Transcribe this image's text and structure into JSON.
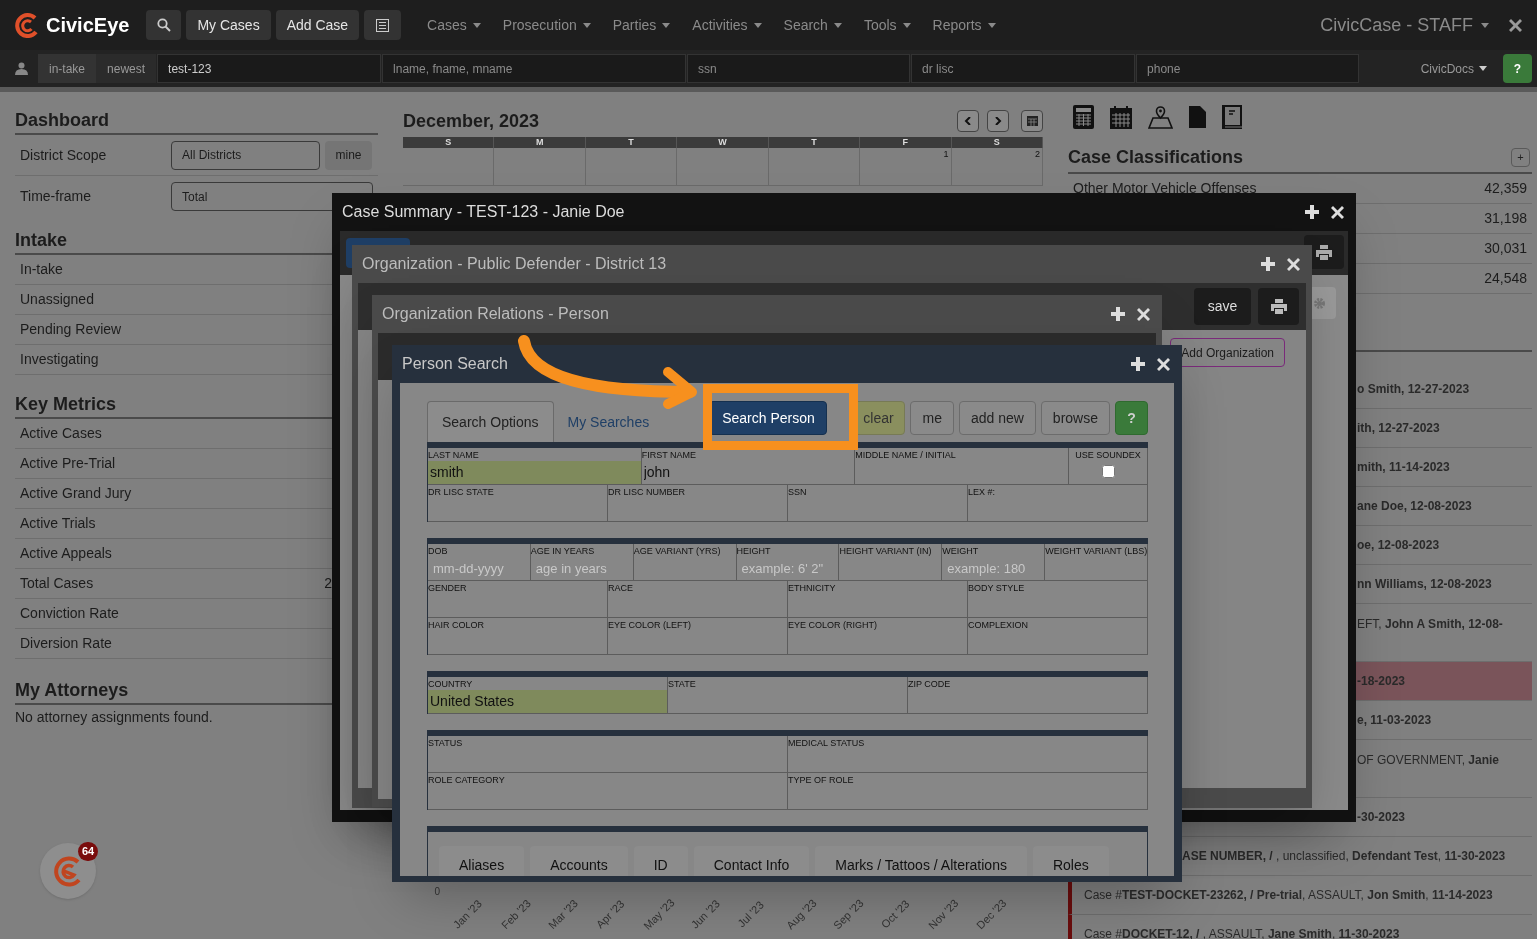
{
  "nav": {
    "brand": "CivicEye",
    "buttons": [
      "My Cases",
      "Add Case"
    ],
    "menus": [
      "Cases",
      "Prosecution",
      "Parties",
      "Activities",
      "Search",
      "Tools",
      "Reports"
    ],
    "app_title": "CivicCase - STAFF"
  },
  "quick_search": {
    "tags": [
      "in-take",
      "newest"
    ],
    "fields": [
      {
        "value": "test-123"
      },
      {
        "placeholder": "lname, fname, mname"
      },
      {
        "placeholder": "ssn"
      },
      {
        "placeholder": "dr lisc"
      },
      {
        "placeholder": "phone"
      }
    ],
    "docs": "CivicDocs",
    "help": "?"
  },
  "dashboard": {
    "title": "Dashboard",
    "scope_label": "District Scope",
    "scope_value": "All Districts",
    "mine": "mine",
    "timeframe_label": "Time-frame",
    "timeframe_value": "Total"
  },
  "intake": {
    "title": "Intake",
    "items": [
      "In-take",
      "Unassigned",
      "Pending Review",
      "Investigating"
    ]
  },
  "key_metrics": {
    "title": "Key Metrics",
    "items": [
      {
        "label": "Active Cases"
      },
      {
        "label": "Active Pre-Trial"
      },
      {
        "label": "Active Grand Jury"
      },
      {
        "label": "Active Trials"
      },
      {
        "label": "Active Appeals"
      },
      {
        "label": "Total Cases",
        "value": "2"
      },
      {
        "label": "Conviction Rate"
      },
      {
        "label": "Diversion Rate"
      }
    ]
  },
  "attorneys": {
    "title": "My Attorneys",
    "message": "No attorney assignments found."
  },
  "calendar": {
    "title": "December, 2023",
    "days": [
      "S",
      "M",
      "T",
      "W",
      "T",
      "F",
      "S"
    ],
    "first_week": [
      "1",
      "2"
    ]
  },
  "case_classifications": {
    "title": "Case Classifications",
    "add": "+",
    "rows": [
      {
        "label": "Other Motor Vehicle Offenses",
        "value": "42,359"
      },
      {
        "value": "31,198"
      },
      {
        "value": "30,031"
      },
      {
        "value": "24,548"
      }
    ]
  },
  "recent_cases": [
    {
      "text": "**o Smith, 12-27-2023**",
      "highlighted": false,
      "flagged": false
    },
    {
      "text": "**ith, 12-27-2023**",
      "highlighted": false,
      "flagged": false
    },
    {
      "text": "**mith, 11-14-2023**",
      "highlighted": false,
      "flagged": false
    },
    {
      "text": "**ane Doe, 12-08-2023**",
      "highlighted": false,
      "flagged": false
    },
    {
      "text": "**oe, 12-08-2023**",
      "highlighted": false,
      "flagged": false
    },
    {
      "text": "**nn Williams, 12-08-2023**",
      "highlighted": false,
      "flagged": false
    },
    {
      "text": "EFT, **John A Smith, 12-08-**",
      "highlighted": false,
      "flagged": false
    },
    {
      "text": "**-18-2023**",
      "highlighted": true,
      "flagged": false
    },
    {
      "text": "**e, 11-03-2023**",
      "highlighted": false,
      "flagged": false
    },
    {
      "text": "OF GOVERNMENT, **Janie**",
      "highlighted": false,
      "flagged": false
    },
    {
      "text": "**-30-2023**",
      "highlighted": false,
      "flagged": false
    },
    {
      "text": "**ASE NUMBER, /** , unclassified, **Defendant Test**, **11-30-2023**",
      "highlighted": false,
      "flagged": false
    },
    {
      "text": "Case #**TEST-DOCKET-23262, / Pre-trial**, ASSAULT, **Jon Smith**, **11-14-2023**",
      "highlighted": false,
      "flagged": true
    },
    {
      "text": "Case #**DOCKET-12, /** , ASSAULT, **Jane Smith**, **11-30-2023**",
      "highlighted": false,
      "flagged": true
    }
  ],
  "chart_axis": {
    "y_tick": "0",
    "months": [
      "Jan '23",
      "Feb '23",
      "Mar '23",
      "Apr '23",
      "May '23",
      "Jun '23",
      "Jul '23",
      "Aug '23",
      "Sep '23",
      "Oct '23",
      "Nov '23",
      "Dec '23"
    ]
  },
  "chat": {
    "badge": "64"
  },
  "case_summary": {
    "title": "Case Summary - TEST-123 - Janie Doe"
  },
  "organization": {
    "title": "Organization - Public Defender - District 13",
    "save": "save",
    "add_organization": "Add Organization"
  },
  "org_relations": {
    "title": "Organization Relations - Person"
  },
  "person_search": {
    "title": "Person Search",
    "tabs": [
      {
        "label": "Search Options",
        "selected": true
      },
      {
        "label": "My Searches",
        "selected": false
      }
    ],
    "buttons": [
      {
        "label": "Search Person",
        "kind": "primary"
      },
      {
        "label": "clear",
        "kind": "warning"
      },
      {
        "label": "me",
        "kind": "default"
      },
      {
        "label": "add new",
        "kind": "default"
      },
      {
        "label": "browse",
        "kind": "default"
      },
      {
        "label": "?",
        "kind": "help"
      }
    ],
    "form": [
      {
        "rows": [
          [
            {
              "label": "LAST NAME",
              "value": "smith",
              "highlighted": true
            },
            {
              "label": "FIRST NAME",
              "value": "john",
              "highlighted": false
            },
            {
              "label": "MIDDLE NAME / INITIAL",
              "highlighted": false
            },
            {
              "label": "USE SOUNDEX",
              "kind": "checkbox",
              "checked": false
            }
          ],
          [
            {
              "label": "DR LISC STATE",
              "highlighted": false
            },
            {
              "label": "DR LISC NUMBER",
              "highlighted": false
            },
            {
              "label": "SSN",
              "highlighted": false
            },
            {
              "label": "LEX #:",
              "highlighted": false
            }
          ]
        ]
      },
      {
        "rows": [
          [
            {
              "label": "DOB",
              "placeholder": "mm-dd-yyyy",
              "highlighted": false
            },
            {
              "label": "AGE IN YEARS",
              "placeholder": "age in years",
              "highlighted": false
            },
            {
              "label": "AGE VARIANT (YRS)",
              "highlighted": false
            },
            {
              "label": "HEIGHT",
              "placeholder": "example: 6' 2\"",
              "highlighted": false
            },
            {
              "label": "HEIGHT VARIANT (IN)",
              "highlighted": false
            },
            {
              "label": "WEIGHT",
              "placeholder": "example: 180",
              "highlighted": false
            },
            {
              "label": "WEIGHT VARIANT (LBS)",
              "highlighted": false
            }
          ],
          [
            {
              "label": "GENDER",
              "highlighted": false
            },
            {
              "label": "RACE",
              "highlighted": false
            },
            {
              "label": "ETHNICITY",
              "highlighted": false
            },
            {
              "label": "BODY STYLE",
              "highlighted": false
            }
          ],
          [
            {
              "label": "HAIR COLOR",
              "highlighted": false
            },
            {
              "label": "EYE COLOR (LEFT)",
              "highlighted": false
            },
            {
              "label": "EYE COLOR (RIGHT)",
              "highlighted": false
            },
            {
              "label": "COMPLEXION",
              "highlighted": false
            }
          ]
        ]
      },
      {
        "rows": [
          [
            {
              "label": "COUNTRY",
              "value": "United States",
              "highlighted": true
            },
            {
              "label": "STATE",
              "highlighted": false
            },
            {
              "label": "ZIP CODE",
              "highlighted": false
            }
          ]
        ]
      },
      {
        "rows": [
          [
            {
              "label": "STATUS",
              "highlighted": false
            },
            {
              "label": "MEDICAL STATUS",
              "highlighted": false
            }
          ],
          [
            {
              "label": "ROLE CATEGORY",
              "highlighted": false
            },
            {
              "label": "TYPE OF ROLE",
              "highlighted": false
            }
          ]
        ]
      }
    ],
    "bottom_tabs": [
      "Aliases",
      "Accounts",
      "ID",
      "Contact Info",
      "Marks / Tattoos / Alterations",
      "Roles"
    ]
  }
}
